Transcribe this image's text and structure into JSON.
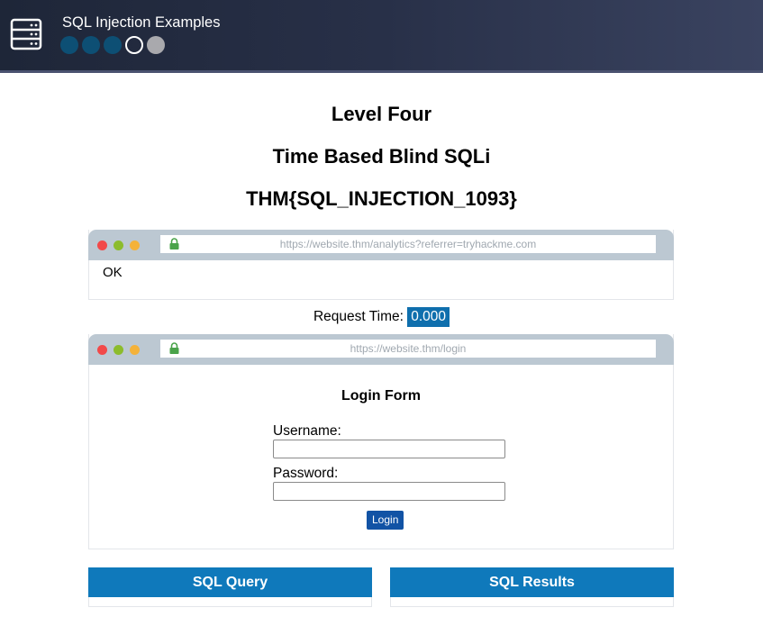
{
  "header": {
    "title": "SQL Injection Examples",
    "icon": "server-icon",
    "levels": [
      {
        "state": "completed"
      },
      {
        "state": "completed"
      },
      {
        "state": "completed"
      },
      {
        "state": "current"
      },
      {
        "state": "locked"
      }
    ]
  },
  "main": {
    "level_title": "Level Four",
    "level_type": "Time Based Blind SQLi",
    "flag": "THM{SQL_INJECTION_1093}"
  },
  "analytics_browser": {
    "url": "https://website.thm/analytics?referrer=tryhackme.com",
    "response": "OK"
  },
  "request_time": {
    "label": "Request Time:",
    "value": "0.000"
  },
  "login_browser": {
    "url": "https://website.thm/login",
    "form_title": "Login Form",
    "username_label": "Username:",
    "username_value": "",
    "password_label": "Password:",
    "password_value": "",
    "login_button": "Login"
  },
  "panels": {
    "query_title": "SQL Query",
    "results_title": "SQL Results"
  },
  "colors": {
    "accent": "#0f79bb",
    "button": "#1253a5",
    "completed_dot": "#0d4f74",
    "locked_dot": "#a9a9ad"
  }
}
